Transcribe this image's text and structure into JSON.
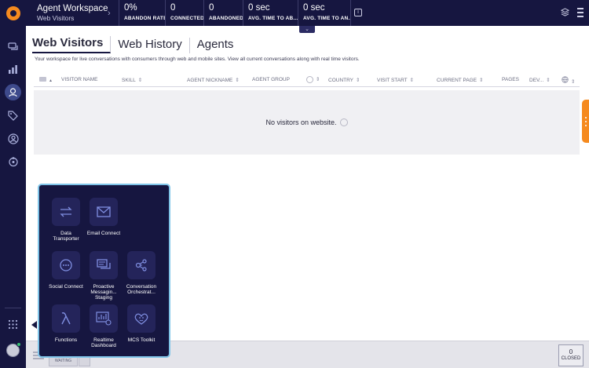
{
  "header": {
    "title": "Agent Workspace",
    "subtitle": "Web Visitors",
    "chevron": "›",
    "kpis": [
      {
        "value": "0%",
        "label": "ABANDON RATE"
      },
      {
        "value": "0",
        "label": "CONNECTED"
      },
      {
        "value": "0",
        "label": "ABANDONED"
      },
      {
        "value": "0 sec",
        "label": "AVG. TIME TO AB..."
      },
      {
        "value": "0 sec",
        "label": "AVG. TIME TO AN..."
      }
    ],
    "info_icon": "i",
    "collapse_icon": "⌄"
  },
  "nav": {
    "items": [
      {
        "name": "conversations-icon"
      },
      {
        "name": "analytics-icon"
      },
      {
        "name": "agent-workspace-icon"
      },
      {
        "name": "tag-icon"
      },
      {
        "name": "users-icon"
      },
      {
        "name": "automation-icon"
      }
    ],
    "apps_icon": "apps-grid-icon",
    "avatar_icon": "avatar-icon"
  },
  "tabs": [
    "Web Visitors",
    "Web History",
    "Agents"
  ],
  "description": "Your workspace for live conversations with consumers through web and mobile sites. View all current conversations along with real time visitors.",
  "table": {
    "columns": [
      "VISITOR NAME",
      "SKILL",
      "AGENT NICKNAME",
      "AGENT GROUP",
      "",
      "COUNTRY",
      "VISIT START",
      "CURRENT PAGE",
      "PAGES",
      "DEV..."
    ],
    "sort_symbol": "⇕",
    "empty_text": "No visitors on website."
  },
  "bottombar": {
    "waiting_label": "WAITING",
    "closed_count": "0",
    "closed_label": "CLOSED"
  },
  "launcher": {
    "apps": [
      {
        "label": "Data Transporter",
        "icon": "data-transporter-icon"
      },
      {
        "label": "Email Connect",
        "icon": "email-icon"
      },
      {
        "label": "Social Connect",
        "icon": "social-connect-icon"
      },
      {
        "label": "Proactive Messagin... Staging",
        "icon": "proactive-messaging-icon"
      },
      {
        "label": "Conversation Orchestrat...",
        "icon": "conversation-orchestrator-icon"
      },
      {
        "label": "Functions",
        "icon": "lambda-icon"
      },
      {
        "label": "Realtime Dashboard",
        "icon": "dashboard-icon"
      },
      {
        "label": "MCS Toolkit",
        "icon": "mcs-toolkit-icon"
      }
    ]
  },
  "colors": {
    "navy": "#161640",
    "accent_orange": "#f58a1f",
    "launcher_border": "#7fc4e8"
  }
}
